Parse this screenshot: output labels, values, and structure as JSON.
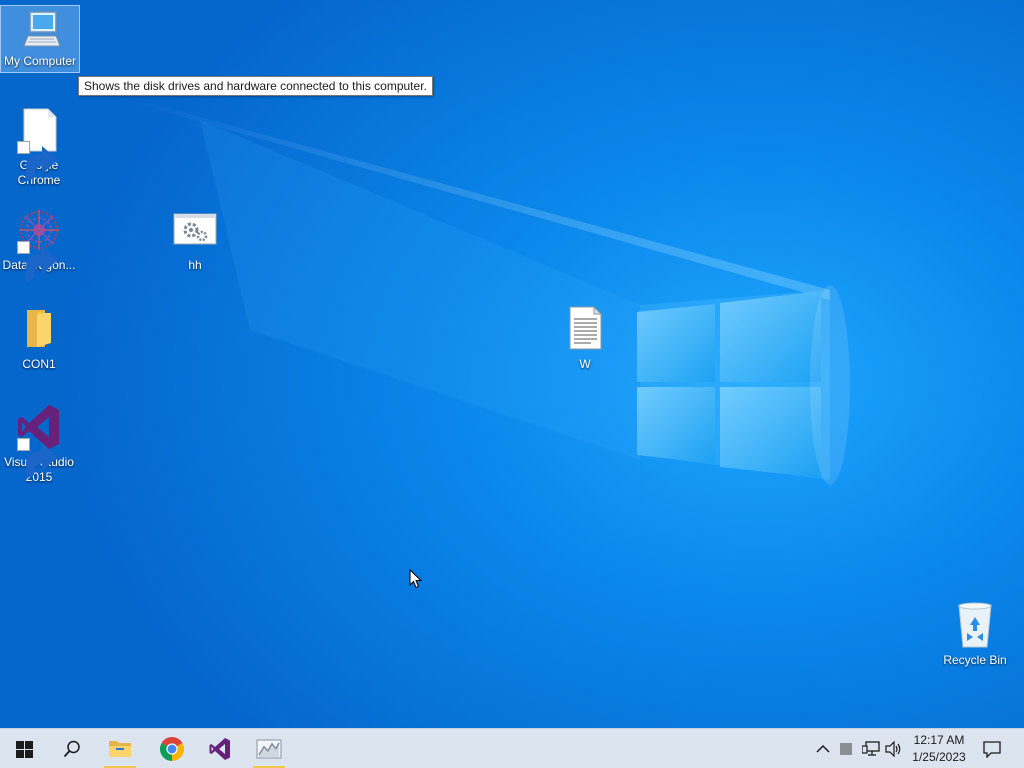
{
  "desktop": {
    "icons": [
      {
        "label": "My Computer",
        "icon": "computer-icon"
      },
      {
        "label": "Google\nChrome",
        "icon": "document-icon"
      },
      {
        "label": "DataWagon...",
        "icon": "datawagon-icon"
      },
      {
        "label": "hh",
        "icon": "settings-window-icon"
      },
      {
        "label": "CON1",
        "icon": "folder-icon"
      },
      {
        "label": "W",
        "icon": "text-file-icon"
      },
      {
        "label": "Visual Studio\n2015",
        "icon": "visual-studio-icon"
      },
      {
        "label": "Recycle Bin",
        "icon": "recycle-bin-icon"
      }
    ],
    "tooltip": "Shows the disk drives and hardware connected to this computer."
  },
  "taskbar": {
    "buttons": [
      {
        "name": "start-button",
        "icon": "windows-logo-icon"
      },
      {
        "name": "search-button",
        "icon": "search-icon"
      },
      {
        "name": "file-explorer-button",
        "icon": "folder-icon"
      },
      {
        "name": "chrome-button",
        "icon": "chrome-icon"
      },
      {
        "name": "visual-studio-button",
        "icon": "visual-studio-icon"
      },
      {
        "name": "app-button",
        "icon": "chart-app-icon"
      }
    ],
    "tray": [
      "chevron-up-icon",
      "square-icon",
      "network-icon",
      "volume-icon"
    ],
    "clock": {
      "time": "12:17 AM",
      "date": "1/25/2023"
    },
    "notification_icon": "notification-icon"
  },
  "colors": {
    "wallpaper_blue": "#0a86ea",
    "taskbar_bg": "#dbe4ef",
    "active_indicator": "#f2c94c",
    "vs_purple": "#68217a"
  }
}
